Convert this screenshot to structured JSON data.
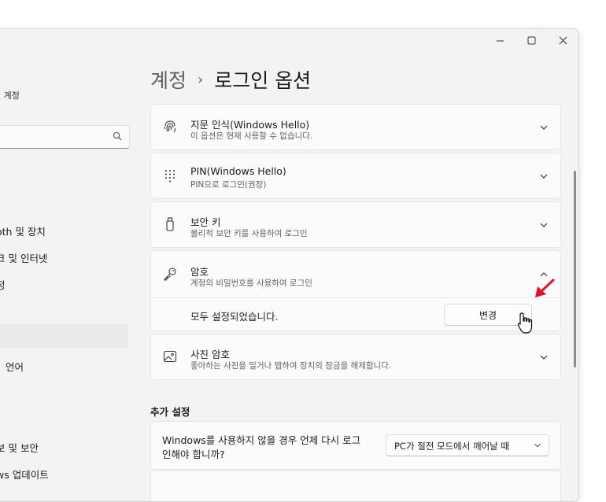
{
  "window_controls": {
    "minimize": "—",
    "maximize": "☐",
    "close": "✕"
  },
  "sidebar": {
    "account_label": "설 계정",
    "search_placeholder": "",
    "items": [
      {
        "label": "oth 및 장치"
      },
      {
        "label": "크 및 인터넷"
      },
      {
        "label": "정"
      },
      {
        "label": ""
      },
      {
        "label": "언어"
      },
      {
        "label": "보 및 보안"
      },
      {
        "label": "ws 업데이트"
      }
    ]
  },
  "header": {
    "parent": "계정",
    "separator": "›",
    "current": "로그인 옵션"
  },
  "cards": [
    {
      "title": "지문 인식(Windows Hello)",
      "subtitle": "이 옵션은 현재 사용할 수 없습니다.",
      "icon": "fingerprint-icon"
    },
    {
      "title": "PIN(Windows Hello)",
      "subtitle": "PIN으로 로그인(권장)",
      "icon": "pin-keypad-icon"
    },
    {
      "title": "보안 키",
      "subtitle": "물리적 보안 키를 사용하여 로그인",
      "icon": "usb-key-icon"
    },
    {
      "title": "암호",
      "subtitle": "계정의 비밀번호를 사용하여 로그인",
      "icon": "key-icon",
      "expanded": true
    },
    {
      "title": "사진 암호",
      "subtitle": "좋아하는 사진을 밀거나 탭하여 장치의 잠금을 해제합니다.",
      "icon": "picture-icon"
    }
  ],
  "password_expanded": {
    "status": "모두 설정되었습니다.",
    "button": "변경"
  },
  "additional": {
    "section_title": "추가 설정",
    "signin_question_line1": "Windows를 사용하지 않을 경우 언제 다시 로그",
    "signin_question_line2": "인해야 합니까?",
    "dropdown_value": "PC가 절전 모드에서 깨어날 때"
  },
  "colors": {
    "annotation_arrow": "#e81123",
    "accent": "#0067c0"
  }
}
